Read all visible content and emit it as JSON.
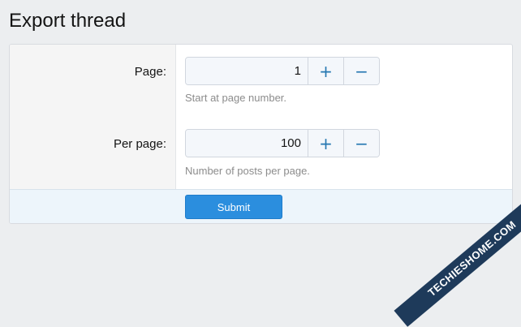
{
  "page": {
    "title": "Export thread"
  },
  "form": {
    "page_field": {
      "label": "Page:",
      "value": "1",
      "hint": "Start at page number."
    },
    "per_page_field": {
      "label": "Per page:",
      "value": "100",
      "hint": "Number of posts per page."
    },
    "increment_symbol": "+",
    "decrement_symbol": "−",
    "submit_label": "Submit"
  },
  "watermark": {
    "text": "TECHIESHOME.COM"
  },
  "colors": {
    "accent": "#2577b1",
    "submit": "#2b8ede",
    "footer": "#edf5fb",
    "watermark": "#1e3a5a"
  }
}
